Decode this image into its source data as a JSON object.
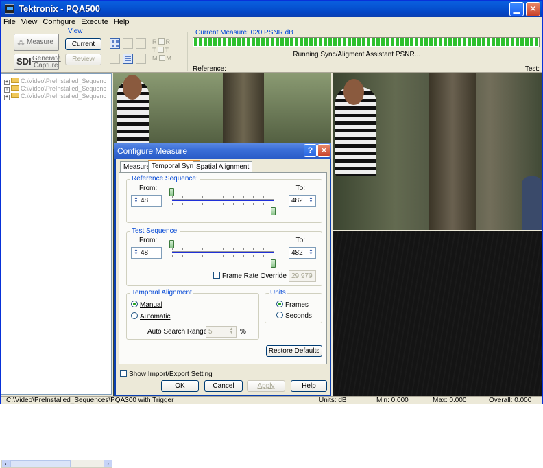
{
  "window": {
    "title": "Tektronix - PQA500"
  },
  "menu": [
    "File",
    "View",
    "Configure",
    "Execute",
    "Help"
  ],
  "toolbar": {
    "measure_label": "Measure",
    "generate_label": "Generate",
    "capture_label": "Capture",
    "sdi_label": "SDI",
    "view_group_label": "View",
    "current_label": "Current",
    "review_label": "Review",
    "rtm": [
      {
        "left": "R",
        "right": "R"
      },
      {
        "left": "T",
        "right": "T"
      },
      {
        "left": "M",
        "right": "M"
      }
    ]
  },
  "measure": {
    "current": "Current Measure: 020 PSNR dB",
    "status": "Running Sync/Aligment Assistant PSNR...",
    "progress": 1.0,
    "reference_label": "Reference:",
    "test_label": "Test:"
  },
  "tree": {
    "items": [
      "C:\\Video\\PreInstalled_Sequenc",
      "C:\\Video\\PreInstalled_Sequenc",
      "C:\\Video\\PreInstalled_Sequenc"
    ]
  },
  "dialog": {
    "title": "Configure Measure",
    "help_glyph": "?",
    "close_glyph": "✕",
    "tabs": [
      "Measure",
      "Temporal Sync",
      "Spatial Alignment"
    ],
    "reference": {
      "label": "Reference Sequence:",
      "from_label": "From:",
      "to_label": "To:",
      "from_value": "48",
      "to_value": "482",
      "from_fraction": 0.0,
      "to_fraction": 1.0
    },
    "test": {
      "label": "Test Sequence:",
      "from_label": "From:",
      "to_label": "To:",
      "from_value": "48",
      "to_value": "482",
      "from_fraction": 0.0,
      "to_fraction": 1.0
    },
    "frame_rate_override_label": "Frame Rate Override (Hz)",
    "frame_rate_value": "29.970",
    "temporal_alignment": {
      "label": "Temporal Alignment",
      "manual": "Manual",
      "automatic": "Automatic",
      "selected": "Manual",
      "search_range_label": "Auto Search Range ±",
      "search_range_value": "5",
      "search_range_unit": "%"
    },
    "units": {
      "label": "Units",
      "frames": "Frames",
      "seconds": "Seconds",
      "selected": "Frames"
    },
    "restore_defaults": "Restore Defaults",
    "show_import_export": "Show Import/Export Setting",
    "ok": "OK",
    "cancel": "Cancel",
    "apply": "Apply",
    "help": "Help"
  },
  "status": {
    "path": "C:\\Video\\PreInstalled_Sequences\\PQA300 with Trigger",
    "units": "Units: dB",
    "min": "Min: 0.000",
    "max": "Max: 0.000",
    "overall": "Overall: 0.000"
  }
}
